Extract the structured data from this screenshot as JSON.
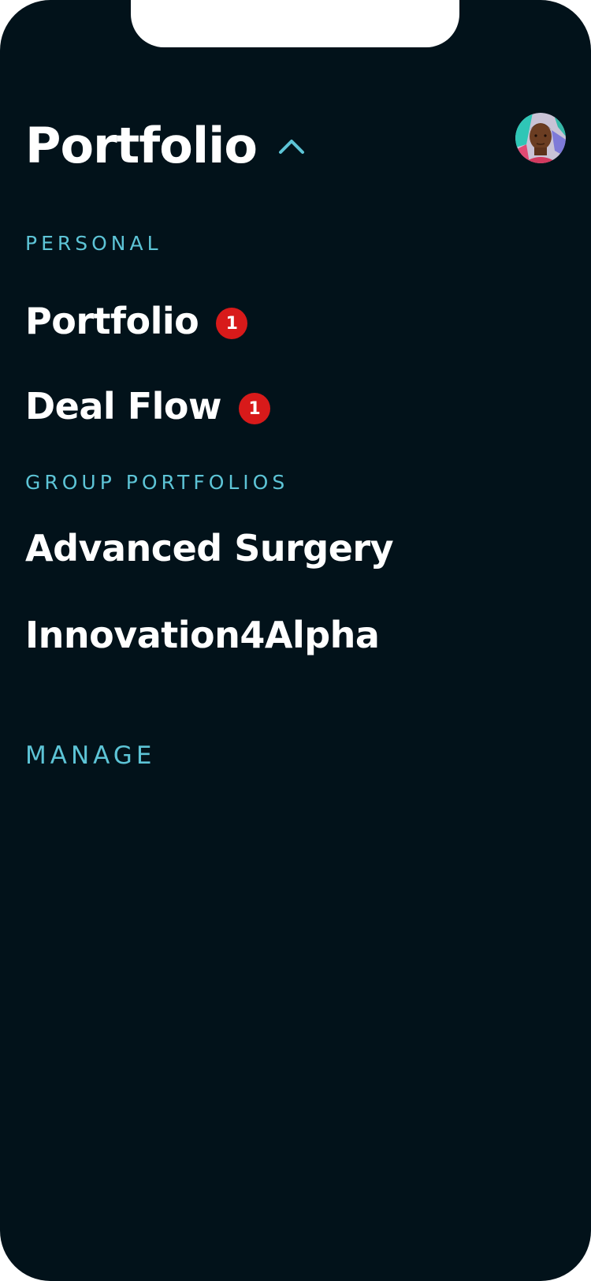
{
  "header": {
    "title": "Portfolio"
  },
  "sections": {
    "personal": {
      "label": "PERSONAL",
      "items": [
        {
          "label": "Portfolio",
          "badge": "1"
        },
        {
          "label": "Deal Flow",
          "badge": "1"
        }
      ]
    },
    "group": {
      "label": "GROUP PORTFOLIOS",
      "items": [
        {
          "label": "Advanced Surgery"
        },
        {
          "label": "Innovation4Alpha"
        }
      ]
    },
    "manage": {
      "label": "MANAGE"
    }
  },
  "colors": {
    "background": "#02121a",
    "accent": "#5dc4d6",
    "badge": "#d81a1a",
    "text": "#ffffff"
  },
  "icons": {
    "chevron": "chevron-up-icon",
    "avatar": "user-avatar"
  }
}
